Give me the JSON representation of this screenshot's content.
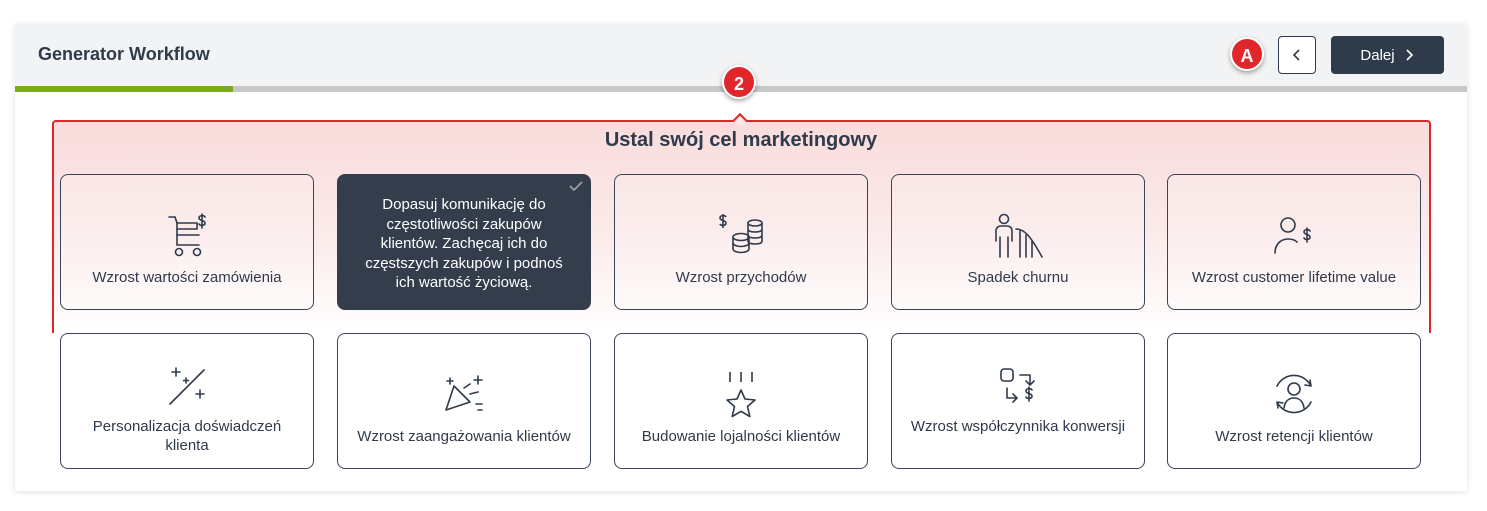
{
  "header": {
    "title": "Generator Workflow",
    "badge_a": "A",
    "badge_step": "2",
    "next_label": "Dalej"
  },
  "progress": {
    "fraction": 0.15
  },
  "section_title": "Ustal swój cel marketingowy",
  "goals": [
    {
      "label": "Wzrost wartości zamówienia",
      "icon": "cart-dollar-icon"
    },
    {
      "label": "",
      "icon": "",
      "selected": true,
      "description": "Dopasuj komunikację do częstotliwości zakupów klientów. Zachęcaj ich do częstszych zakupów i podnoś ich wartość życiową."
    },
    {
      "label": "Wzrost przychodów",
      "icon": "coins-dollar-icon"
    },
    {
      "label": "Spadek churnu",
      "icon": "person-decline-icon"
    },
    {
      "label": "Wzrost customer lifetime value",
      "icon": "user-dollar-icon"
    },
    {
      "label": "Personalizacja doświadczeń klienta",
      "icon": "magic-wand-icon"
    },
    {
      "label": "Wzrost zaangażowania klientów",
      "icon": "party-popper-icon"
    },
    {
      "label": "Budowanie lojalności klientów",
      "icon": "star-icon"
    },
    {
      "label": "Wzrost współczynnika konwersji",
      "icon": "conversion-icon"
    },
    {
      "label": "Wzrost retencji klientów",
      "icon": "user-refresh-icon"
    }
  ],
  "colors": {
    "accent": "#e0262b",
    "progress": "#7aab1f",
    "dark": "#2f3a4a"
  }
}
